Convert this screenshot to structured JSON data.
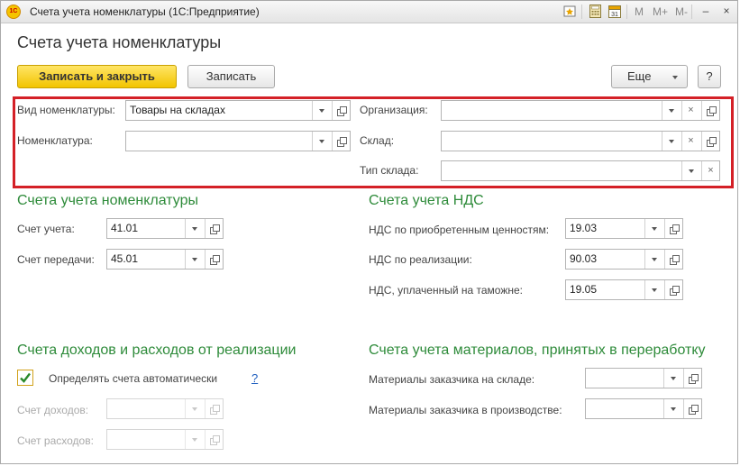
{
  "window": {
    "app_icon": "1C",
    "title": "Счета учета номенклатуры  (1С:Предприятие)",
    "m_labels": [
      "M",
      "M+",
      "M-"
    ],
    "minimize": "–",
    "maximize": "□",
    "close": "×",
    "calendar_day": "31"
  },
  "page_title": "Счета учета номенклатуры",
  "toolbar": {
    "save_close": "Записать и закрыть",
    "save": "Записать",
    "more": "Еще",
    "help": "?"
  },
  "filters": {
    "kind": {
      "label": "Вид номенклатуры:",
      "value": "Товары на складах"
    },
    "item": {
      "label": "Номенклатура:",
      "value": ""
    },
    "org": {
      "label": "Организация:",
      "value": ""
    },
    "warehouse": {
      "label": "Склад:",
      "value": ""
    },
    "warehouse_type": {
      "label": "Тип склада:",
      "value": ""
    }
  },
  "accounts": {
    "title": "Счета учета номенклатуры",
    "account": {
      "label": "Счет учета:",
      "value": "41.01"
    },
    "transfer": {
      "label": "Счет передачи:",
      "value": "45.01"
    }
  },
  "vat": {
    "title": "Счета учета НДС",
    "acquired": {
      "label": "НДС по приобретенным ценностям:",
      "value": "19.03"
    },
    "sales": {
      "label": "НДС по реализации:",
      "value": "90.03"
    },
    "customs": {
      "label": "НДС, уплаченный на таможне:",
      "value": "19.05"
    }
  },
  "income": {
    "title": "Счета доходов и расходов от реализации",
    "auto_label": "Определять счета автоматически",
    "auto_checked": true,
    "help_link": "?",
    "income": {
      "label": "Счет доходов:",
      "value": ""
    },
    "expenses": {
      "label": "Счет расходов:",
      "value": ""
    }
  },
  "materials": {
    "title": "Счета учета материалов, принятых в переработку",
    "stock": {
      "label": "Материалы заказчика на складе:",
      "value": ""
    },
    "production": {
      "label": "Материалы заказчика в производстве:",
      "value": ""
    }
  },
  "colors": {
    "section_title": "#2e8b3a",
    "primary_button": "#f2c400",
    "highlight_frame": "#d42027",
    "checkbox_mark": "#2b8a2b"
  },
  "icons": {
    "dropdown": "chevron-down-icon",
    "open": "open-window-icon",
    "clear": "close-icon"
  }
}
